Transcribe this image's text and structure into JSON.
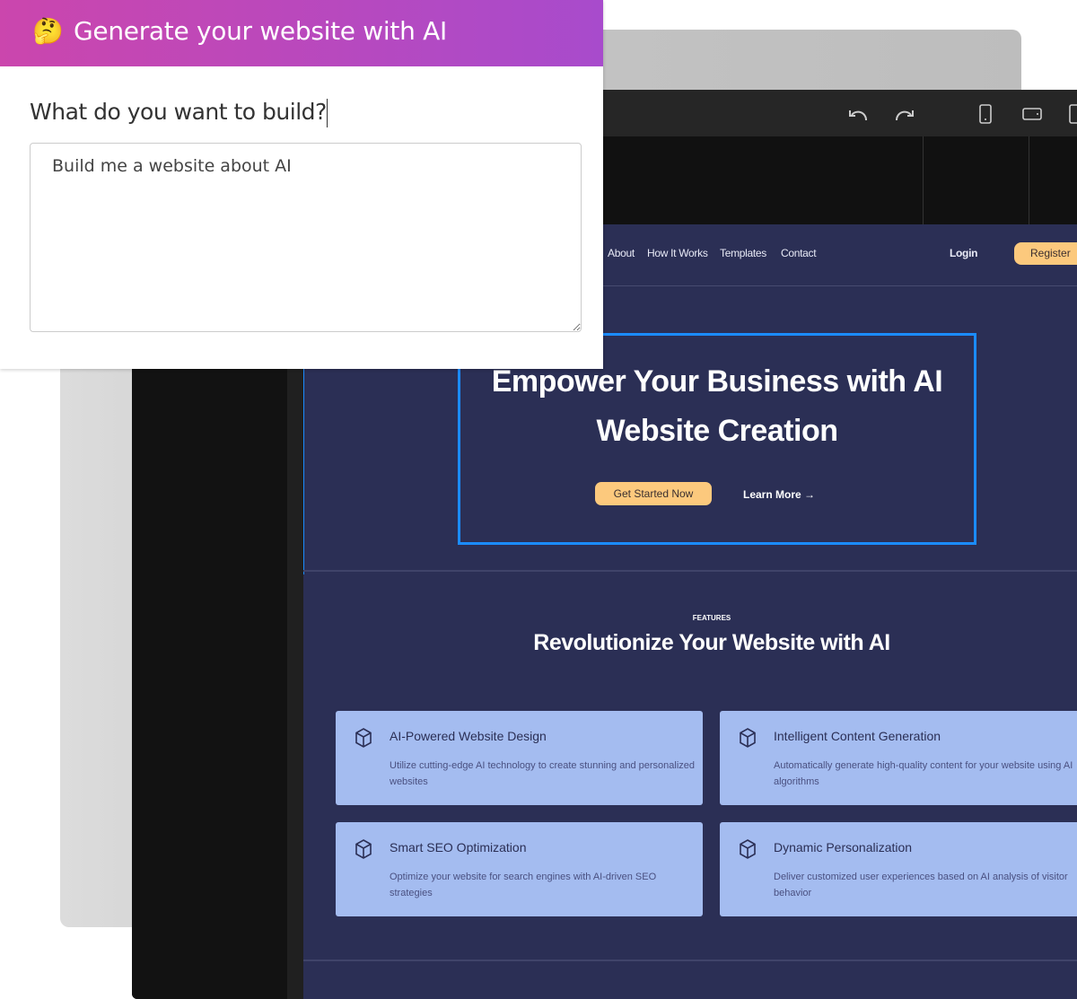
{
  "dialog": {
    "emoji": "🤔",
    "title": "Generate your website with AI",
    "question": "What do you want to build?",
    "prompt_value": "Build me a website about AI"
  },
  "toolbar": {
    "icons": [
      "undo-icon",
      "redo-icon",
      "mobile-view-icon",
      "tablet-view-icon",
      "desktop-view-icon"
    ]
  },
  "site": {
    "nav": [
      "About",
      "How It Works",
      "Templates",
      "Contact"
    ],
    "login": "Login",
    "register": "Register",
    "hero_title_line1": "Empower Your Business with AI",
    "hero_title_line2": "Website Creation",
    "cta_primary": "Get Started Now",
    "cta_secondary": "Learn More →",
    "features_label": "FEATURES",
    "features_title": "Revolutionize Your Website with AI",
    "features": [
      {
        "title": "AI-Powered Website Design",
        "desc": "Utilize cutting-edge AI technology to create stunning and personalized websites"
      },
      {
        "title": "Intelligent Content Generation",
        "desc": "Automatically generate high-quality content for your website using AI algorithms"
      },
      {
        "title": "Smart SEO Optimization",
        "desc": "Optimize your website for search engines with AI-driven SEO strategies"
      },
      {
        "title": "Dynamic Personalization",
        "desc": "Deliver customized user experiences based on AI analysis of visitor behavior"
      }
    ]
  },
  "colors": {
    "header_gradient_start": "#cb46ad",
    "header_gradient_end": "#a84bcc",
    "site_background": "#2b2f55",
    "accent_button": "#fcc97d",
    "card_background": "#a4bcf0",
    "selection_outline": "#1b8cff"
  }
}
